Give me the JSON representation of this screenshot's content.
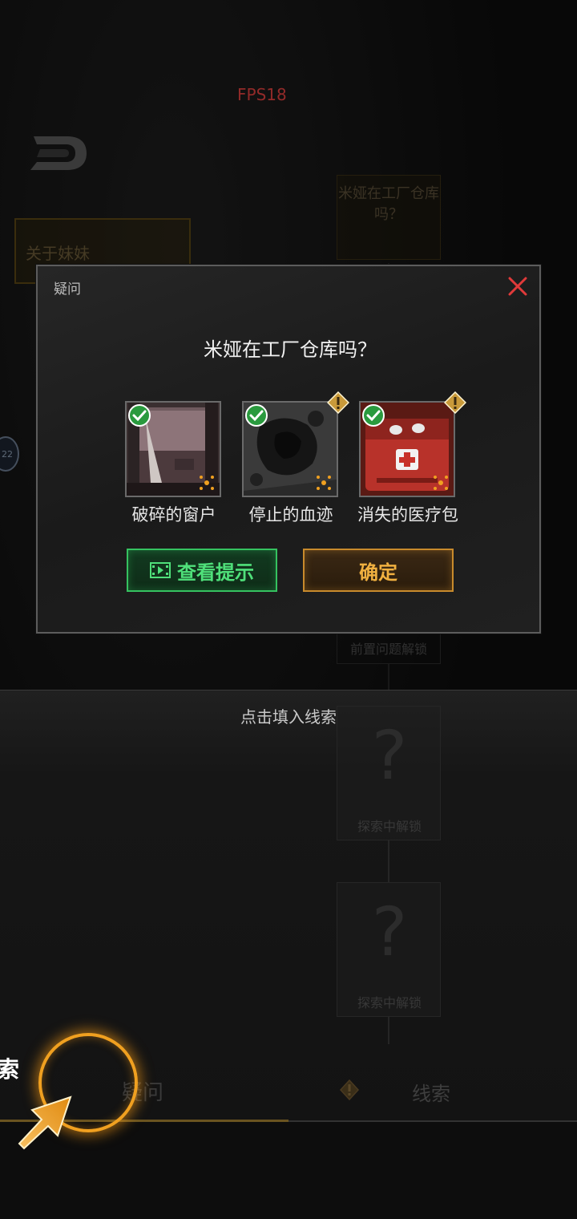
{
  "hud": {
    "fps": "FPS18",
    "side_badge": "22"
  },
  "background": {
    "card_top": "米娅在工厂仓库吗？",
    "card_sister": "关于妹妹",
    "locked_prereq": "前置问题解锁",
    "locked_explore_1": "探索中解锁",
    "locked_explore_2": "探索中解锁",
    "question_mark": "?"
  },
  "dialog": {
    "title": "疑问",
    "question": "米娅在工厂仓库吗？",
    "clues": [
      {
        "name": "破碎的窗户",
        "found": true,
        "warning": false
      },
      {
        "name": "停止的血迹",
        "found": true,
        "warning": true
      },
      {
        "name": "消失的医疗包",
        "found": true,
        "warning": true
      }
    ],
    "hint_button": "查看提示",
    "ok_button": "确定"
  },
  "lower_panel": {
    "hint": "点击填入线索"
  },
  "bottom_tabs": {
    "search": "索",
    "doubt": "疑问",
    "clue": "线索"
  },
  "colors": {
    "fps": "#e0413f",
    "hint_green": "#35c260",
    "ok_orange": "#c88a2c",
    "check_green": "#2a9a3e",
    "close_red": "#e03a3a",
    "tutorial_glow": "#f0a020"
  }
}
